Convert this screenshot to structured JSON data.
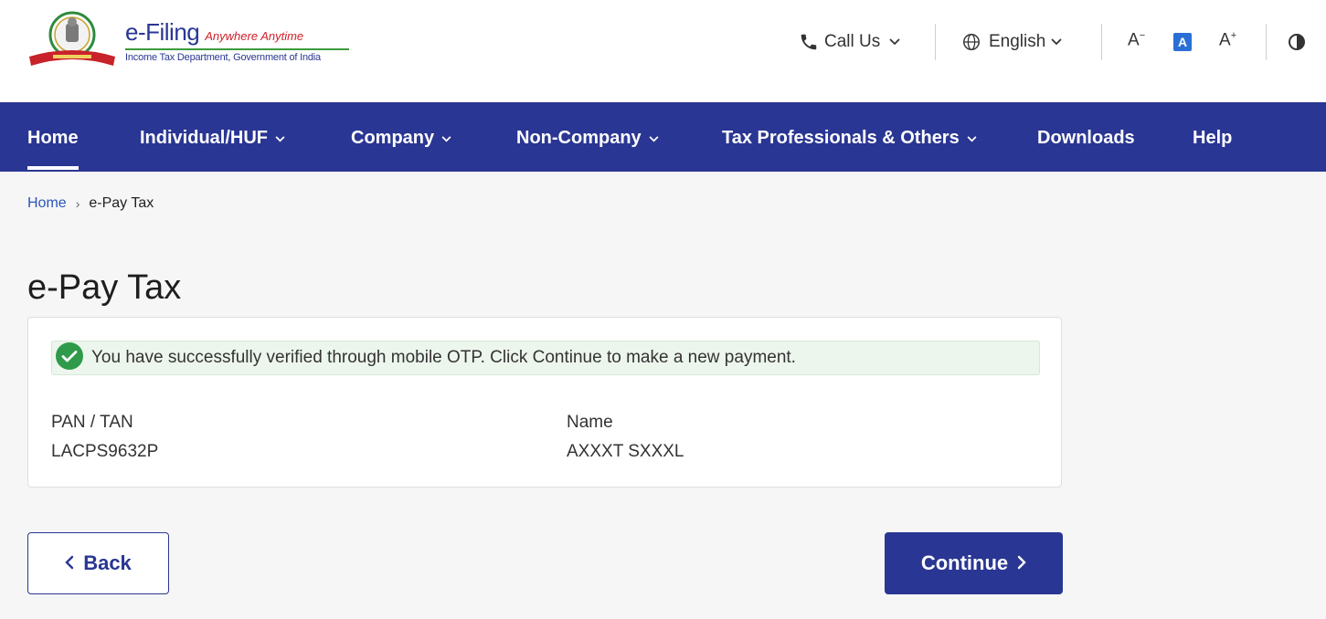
{
  "header": {
    "brand_title": "e-Filing",
    "brand_tagline": "Anywhere Anytime",
    "brand_subtitle": "Income Tax Department, Government of India",
    "call_us": "Call Us",
    "language": "English",
    "font_decrease": "A",
    "font_normal": "A",
    "font_increase": "A"
  },
  "nav": {
    "items": [
      {
        "label": "Home",
        "active": true
      },
      {
        "label": "Individual/HUF",
        "dropdown": true
      },
      {
        "label": "Company",
        "dropdown": true
      },
      {
        "label": "Non-Company",
        "dropdown": true
      },
      {
        "label": "Tax Professionals & Others",
        "dropdown": true
      },
      {
        "label": "Downloads"
      },
      {
        "label": "Help"
      }
    ]
  },
  "breadcrumb": {
    "home": "Home",
    "separator": "›",
    "current": "e-Pay Tax"
  },
  "page": {
    "title": "e-Pay Tax"
  },
  "card": {
    "alert": "You have successfully verified through mobile OTP. Click Continue to make a new payment.",
    "pan_label": "PAN / TAN",
    "pan_value": "LACPS9632P",
    "name_label": "Name",
    "name_value": "AXXXT SXXXL"
  },
  "actions": {
    "back_label": "Back",
    "continue_label": "Continue"
  },
  "colors": {
    "primary": "#2a3693",
    "success": "#2e9a4a",
    "link": "#2a56b8",
    "alert_bg": "#edf6ed"
  }
}
